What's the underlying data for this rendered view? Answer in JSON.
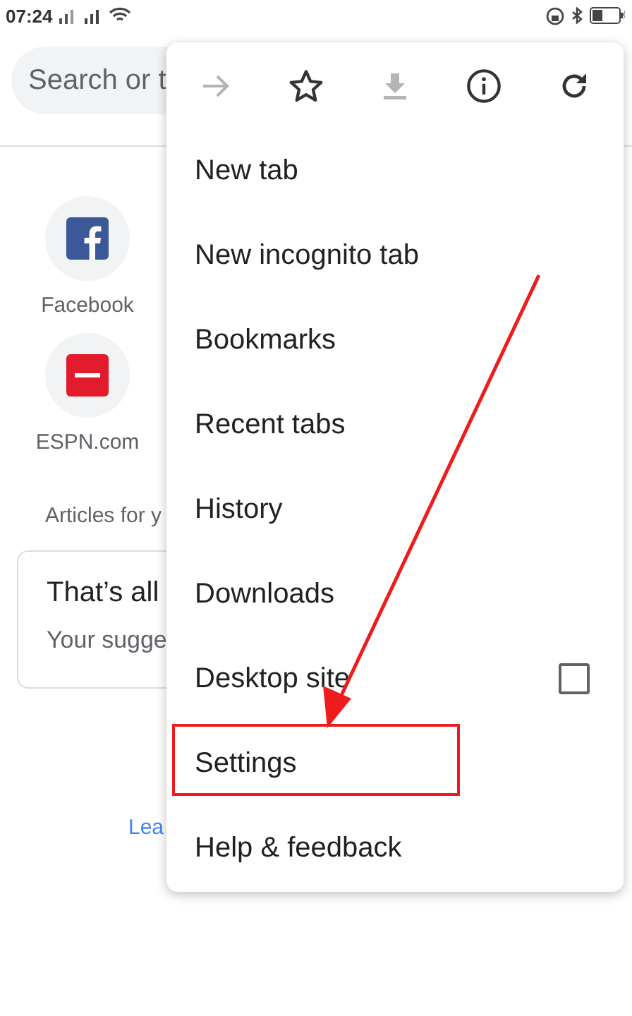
{
  "status_bar": {
    "time": "07:24"
  },
  "search": {
    "placeholder": "Search or t"
  },
  "shortcuts": [
    {
      "label": "Facebook",
      "kind": "facebook"
    },
    {
      "label": "ESPN.com",
      "kind": "espn"
    }
  ],
  "articles_heading": "Articles for y",
  "card": {
    "title": "That’s all",
    "text": "Your sugge"
  },
  "link": "Lea",
  "menu": {
    "toolbar": [
      {
        "kind": "forward",
        "disabled": true
      },
      {
        "kind": "star",
        "disabled": false
      },
      {
        "kind": "download",
        "disabled": true
      },
      {
        "kind": "info",
        "disabled": false
      },
      {
        "kind": "reload",
        "disabled": false
      }
    ],
    "items": [
      {
        "label": "New tab",
        "kind": "item",
        "highlighted": false
      },
      {
        "label": "New incognito tab",
        "kind": "item",
        "highlighted": false
      },
      {
        "label": "Bookmarks",
        "kind": "item",
        "highlighted": false
      },
      {
        "label": "Recent tabs",
        "kind": "item",
        "highlighted": false
      },
      {
        "label": "History",
        "kind": "item",
        "highlighted": false
      },
      {
        "label": "Downloads",
        "kind": "item",
        "highlighted": false
      },
      {
        "label": "Desktop site",
        "kind": "checkbox",
        "checked": false,
        "highlighted": false
      },
      {
        "label": "Settings",
        "kind": "item",
        "highlighted": true
      },
      {
        "label": "Help & feedback",
        "kind": "item",
        "highlighted": false
      }
    ]
  }
}
